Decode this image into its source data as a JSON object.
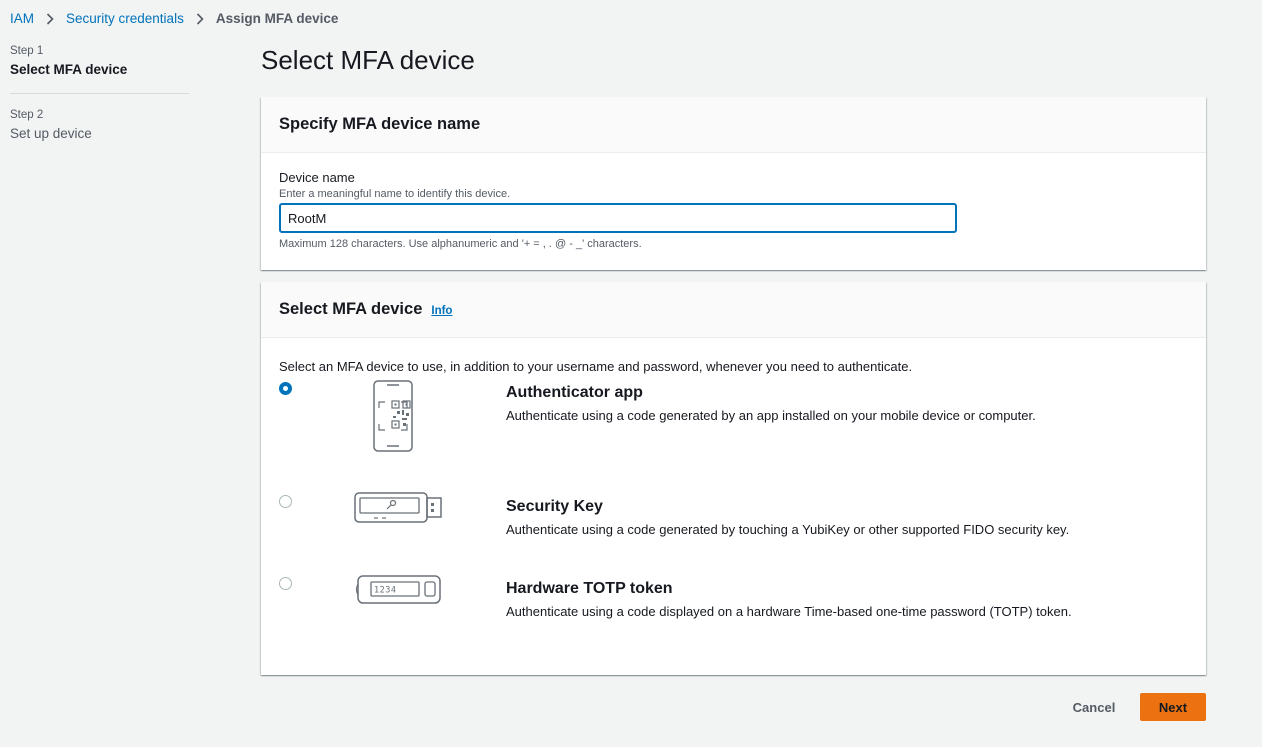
{
  "breadcrumb": {
    "items": [
      {
        "label": "IAM"
      },
      {
        "label": "Security credentials"
      }
    ],
    "current": "Assign MFA device"
  },
  "steps": [
    {
      "number": "Step 1",
      "title": "Select MFA device"
    },
    {
      "number": "Step 2",
      "title": "Set up device"
    }
  ],
  "page": {
    "title": "Select MFA device"
  },
  "name_panel": {
    "title": "Specify MFA device name",
    "field_label": "Device name",
    "field_description": "Enter a meaningful name to identify this device.",
    "field_value": "RootM",
    "field_hint": "Maximum 128 characters. Use alphanumeric and '+ = , . @ - _' characters."
  },
  "device_panel": {
    "title": "Select MFA device",
    "info_label": "Info",
    "intro": "Select an MFA device to use, in addition to your username and password, whenever you need to authenticate.",
    "options": [
      {
        "title": "Authenticator app",
        "description": "Authenticate using a code generated by an app installed on your mobile device or computer.",
        "selected": true,
        "icon": "qr-phone-icon"
      },
      {
        "title": "Security Key",
        "description": "Authenticate using a code generated by touching a YubiKey or other supported FIDO security key.",
        "selected": false,
        "icon": "usb-key-icon"
      },
      {
        "title": "Hardware TOTP token",
        "description": "Authenticate using a code displayed on a hardware Time-based one-time password (TOTP) token.",
        "selected": false,
        "icon": "totp-token-icon"
      }
    ],
    "totp_icon_display": "1234"
  },
  "footer": {
    "cancel_label": "Cancel",
    "next_label": "Next"
  },
  "colors": {
    "link": "#0073bb",
    "primary_button": "#ec7211",
    "background": "#f2f3f3"
  }
}
